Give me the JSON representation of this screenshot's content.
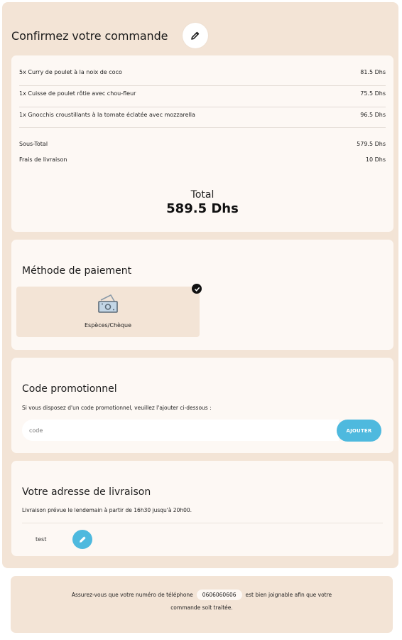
{
  "header": {
    "title": "Confirmez votre commande"
  },
  "order": {
    "items": [
      {
        "label": "5x Curry de poulet à la noix de coco",
        "price": "81.5 Dhs"
      },
      {
        "label": "1x Cuisse de poulet rôtie avec chou-fleur",
        "price": "75.5 Dhs"
      },
      {
        "label": "1x Gnocchis croustillants à la tomate éclatée avec mozzarella",
        "price": "96.5 Dhs"
      }
    ],
    "subtotal_label": "Sous-Total",
    "subtotal_value": "579.5 Dhs",
    "delivery_label": "Frais de livraison",
    "delivery_value": "10 Dhs",
    "total_label": "Total",
    "total_value": "589.5 Dhs"
  },
  "payment": {
    "title": "Méthode de paiement",
    "option_label": "Espèces/Chèque",
    "option_icon": "cash-icon",
    "selected": true
  },
  "promo": {
    "title": "Code promotionnel",
    "description": "Si vous disposez d'un code promotionnel, veuillez l'ajouter ci-dessous :",
    "placeholder": "code",
    "button_label": "AJOUTER"
  },
  "address": {
    "title": "Votre adresse de livraison",
    "description": "Livraison prévue le lendemain à partir de 16h30 jusqu'à 20h00.",
    "value": "test"
  },
  "notice": {
    "text_before": "Assurez-vous que votre numéro de téléphone",
    "phone": "0606060606",
    "text_after": "est bien joignable afin que votre",
    "text_line2": "commande soit traitée."
  },
  "colors": {
    "background": "#f3e4d6",
    "card": "#fdf8f4",
    "accent": "#4eb9de"
  }
}
